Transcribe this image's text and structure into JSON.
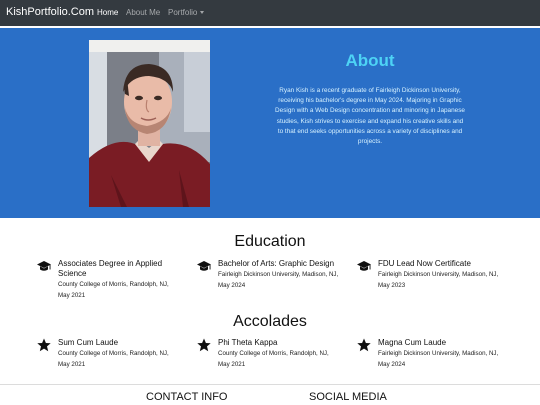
{
  "navbar": {
    "brand": "KishPortfolio.Com",
    "items": [
      {
        "label": "Home"
      },
      {
        "label": "About Me"
      },
      {
        "label": "Portfolio"
      }
    ]
  },
  "about": {
    "title": "About",
    "text": "Ryan Kish is a recent graduate of Fairleigh Dickinson University, receiving his bachelor's degree in May 2024. Majoring in Graphic Design with a Web Design concentration and minoring in Japanese studies, Kish strives to exercise and expand his creative skills and to that end seeks opportunities across a variety of disciplines and projects.",
    "photo_icon": "profile-photo"
  },
  "education": {
    "title": "Education",
    "icon": "graduation-cap-icon",
    "items": [
      {
        "title": "Associates Degree in Applied Science",
        "detail": "County College of Morris, Randolph, NJ, May 2021"
      },
      {
        "title": "Bachelor of Arts: Graphic Design",
        "detail": "Fairleigh Dickinson University, Madison, NJ, May 2024"
      },
      {
        "title": "FDU Lead Now Certificate",
        "detail": "Fairleigh Dickinson University, Madison, NJ, May 2023"
      }
    ]
  },
  "accolades": {
    "title": "Accolades",
    "icon": "star-icon",
    "items": [
      {
        "title": "Sum Cum Laude",
        "detail": "County College of Morris, Randolph, NJ, May 2021"
      },
      {
        "title": "Phi Theta Kappa",
        "detail": "County College of Morris, Randolph, NJ, May 2021"
      },
      {
        "title": "Magna Cum Laude",
        "detail": "Fairleigh Dickinson University, Madison, NJ, May 2024"
      }
    ]
  },
  "footer": {
    "contact": "CONTACT INFO",
    "social": "SOCIAL MEDIA"
  }
}
